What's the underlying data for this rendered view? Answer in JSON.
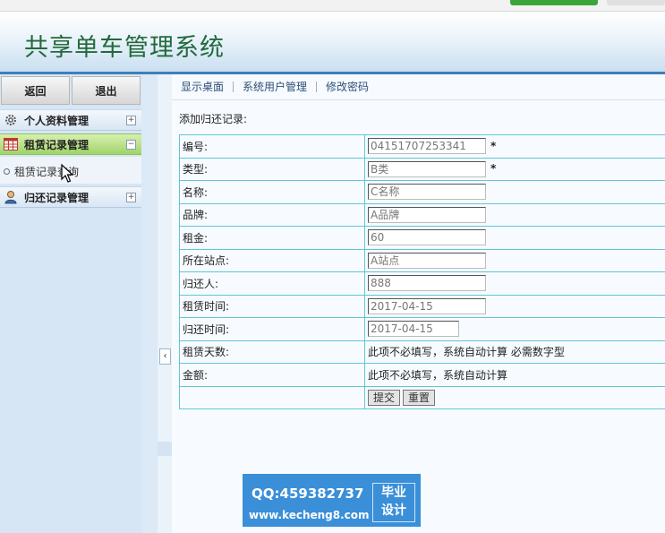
{
  "app": {
    "title": "共享单车管理系统"
  },
  "sidebar": {
    "back_label": "返回",
    "logout_label": "退出",
    "menus": [
      {
        "label": "个人资料管理",
        "icon": "gear-icon",
        "expander": "+"
      },
      {
        "label": "租赁记录管理",
        "icon": "table-icon",
        "expander": "−"
      },
      {
        "label": "归还记录管理",
        "icon": "user-icon",
        "expander": "+"
      }
    ],
    "sub_items": [
      {
        "label": "租赁记录查询"
      }
    ],
    "collapse_arrow": "‹"
  },
  "nav": {
    "links": [
      {
        "label": "显示桌面"
      },
      {
        "label": "系统用户管理"
      },
      {
        "label": "修改密码"
      }
    ]
  },
  "form": {
    "title": "添加归还记录:",
    "rows": [
      {
        "label": "编号:",
        "value": "04151707253341",
        "required": "*"
      },
      {
        "label": "类型:",
        "value": "B类",
        "required": "*"
      },
      {
        "label": "名称:",
        "value": "C名称"
      },
      {
        "label": "品牌:",
        "value": "A品牌"
      },
      {
        "label": "租金:",
        "value": "60"
      },
      {
        "label": "所在站点:",
        "value": "A站点"
      },
      {
        "label": "归还人:",
        "value": "888"
      },
      {
        "label": "租赁时间:",
        "value": "2017-04-15"
      },
      {
        "label": "归还时间:",
        "value": "2017-04-15"
      },
      {
        "label": "租赁天数:",
        "note": "此项不必填写，系统自动计算 必需数字型"
      },
      {
        "label": "金额:",
        "note": "此项不必填写，系统自动计算"
      }
    ],
    "submit_label": "提交",
    "reset_label": "重置"
  },
  "watermark": {
    "qq": "QQ:459382737",
    "url": "www.kecheng8.com",
    "badge_line1": "毕业",
    "badge_line2": "设计"
  }
}
